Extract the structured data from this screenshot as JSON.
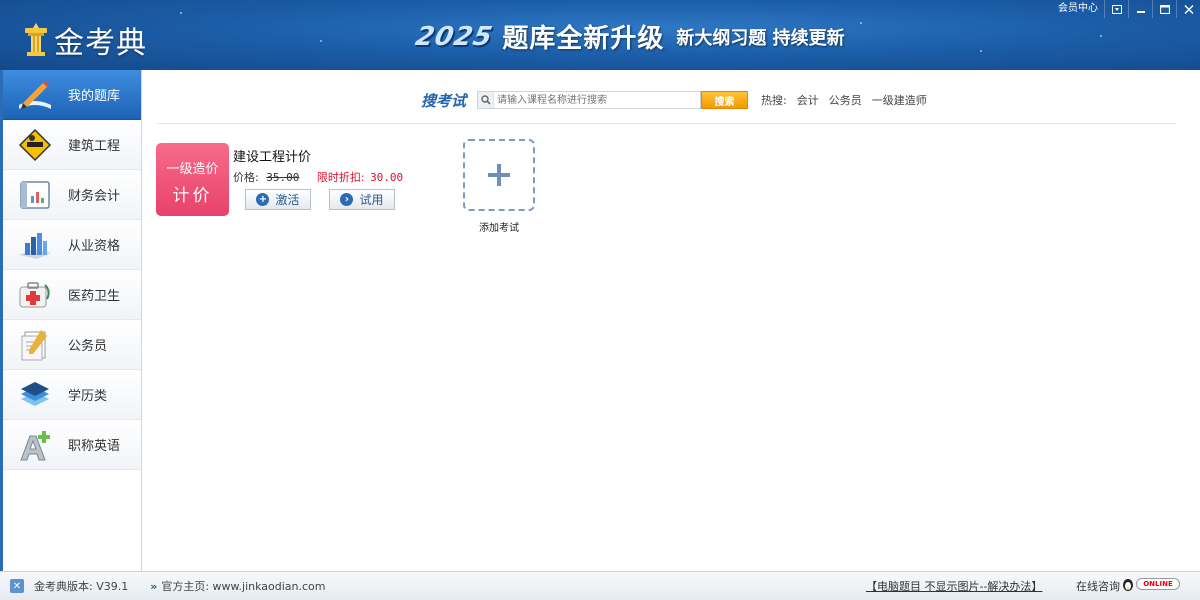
{
  "header": {
    "logo_text": "金考典",
    "banner_year": "2025",
    "banner_main": "题库全新升级",
    "banner_sub": "新大纲习题 持续更新",
    "member_center": "会员中心"
  },
  "sidebar": {
    "items": [
      {
        "label": "我的题库",
        "icon": "pen-book-icon",
        "active": true
      },
      {
        "label": "建筑工程",
        "icon": "construction-sign-icon"
      },
      {
        "label": "财务会计",
        "icon": "ledger-chart-icon"
      },
      {
        "label": "从业资格",
        "icon": "bar-chart-icon"
      },
      {
        "label": "医药卫生",
        "icon": "medical-kit-icon"
      },
      {
        "label": "公务员",
        "icon": "document-stack-icon"
      },
      {
        "label": "学历类",
        "icon": "layers-icon"
      },
      {
        "label": "职称英语",
        "icon": "letter-a-plus-icon"
      }
    ]
  },
  "search": {
    "title": "搜考试",
    "placeholder": "请输入课程名称进行搜索",
    "button": "搜索",
    "hot_label": "热搜:",
    "hot_items": [
      "会计",
      "公务员",
      "一级建造师"
    ]
  },
  "course": {
    "cover_line1": "一级造价",
    "cover_line2": "计价",
    "name": "建设工程计价",
    "price_label": "价格:",
    "price_old": "35.00",
    "discount_label": "限时折扣:",
    "discount_price": "30.00",
    "activate_label": "激活",
    "trial_label": "试用"
  },
  "add_exam": {
    "label": "添加考试"
  },
  "statusbar": {
    "version": "金考典版本: V39.1",
    "home": "官方主页: www.jinkaodian.com",
    "image_problem": "【电脑题目 不显示图片--解决办法】",
    "consult": "在线咨询",
    "online": "ONLINE"
  },
  "colors": {
    "header_blue": "#1c5ea9",
    "active_blue": "#2a6fc4",
    "search_button": "#f5a400",
    "cover_pink": "#f05a7c",
    "discount_red": "#e0102a"
  }
}
